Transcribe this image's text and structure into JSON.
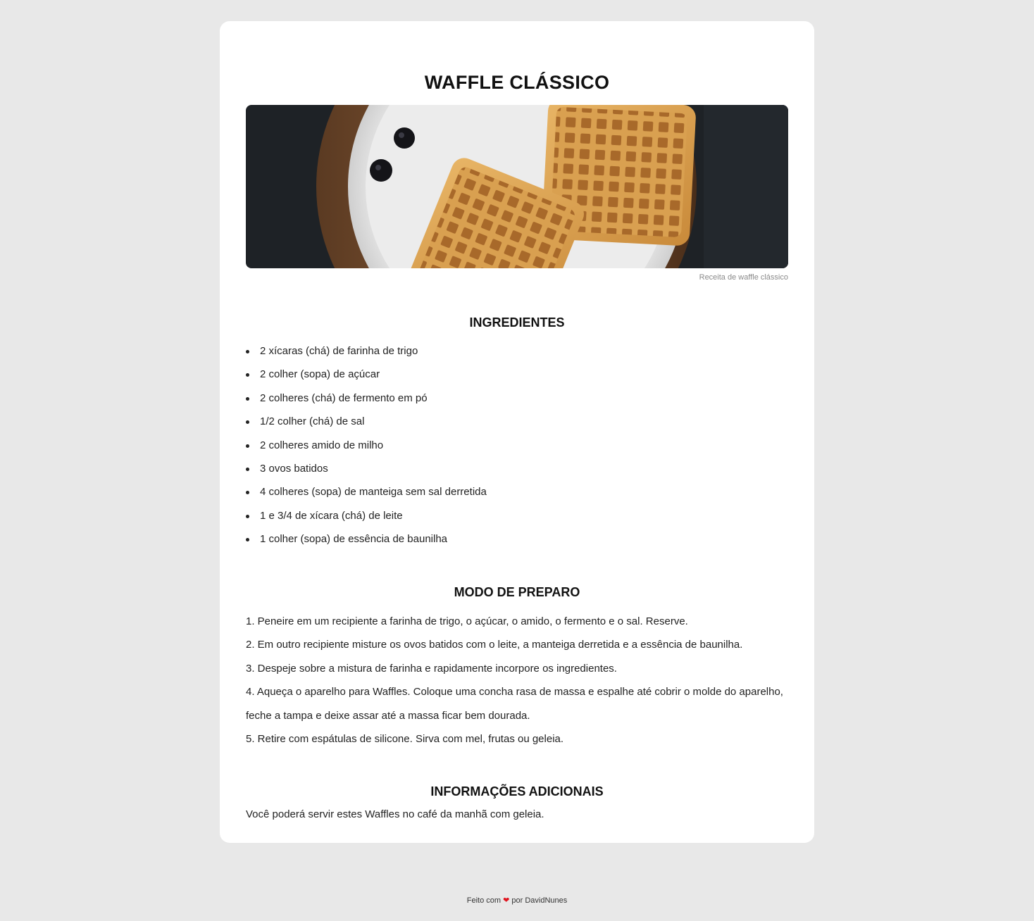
{
  "recipe": {
    "title": "WAFFLE CLÁSSICO",
    "image_caption": "Receita de waffle clássico",
    "sections": {
      "ingredients_title": "INGREDIENTES",
      "method_title": "MODO DE PREPARO",
      "info_title": "INFORMAÇÕES ADICIONAIS"
    },
    "ingredients": [
      "2 xícaras (chá) de farinha de trigo",
      "2 colher (sopa) de açúcar",
      "2 colheres (chá) de fermento em pó",
      "1/2 colher (chá) de sal",
      "2 colheres amido de milho",
      "3 ovos batidos",
      "4 colheres (sopa) de manteiga sem sal derretida",
      "1 e 3/4 de xícara (chá) de leite",
      "1 colher (sopa) de essência de baunilha"
    ],
    "steps": [
      "1. Peneire em um recipiente a farinha de trigo, o açúcar, o amido, o fermento e o sal. Reserve.",
      "2. Em outro recipiente misture os ovos batidos com o leite, a manteiga derretida e a essência de baunilha.",
      "3. Despeje sobre a mistura de farinha e rapidamente incorpore os ingredientes.",
      "4. Aqueça o aparelho para Waffles. Coloque uma concha rasa de massa e espalhe até cobrir o molde do aparelho,",
      "feche a tampa e deixe assar até a massa ficar bem dourada.",
      "5. Retire com espátulas de silicone. Sirva com mel, frutas ou geleia."
    ],
    "additional_info": "Você poderá servir estes Waffles no café da manhã com geleia."
  },
  "footer": {
    "prefix": "Feito com",
    "suffix": "por DavidNunes",
    "heart_icon": "heart-icon",
    "heart_color": "#e0141e"
  },
  "colors": {
    "page_background": "#e8e8e8",
    "card_background": "#ffffff"
  }
}
